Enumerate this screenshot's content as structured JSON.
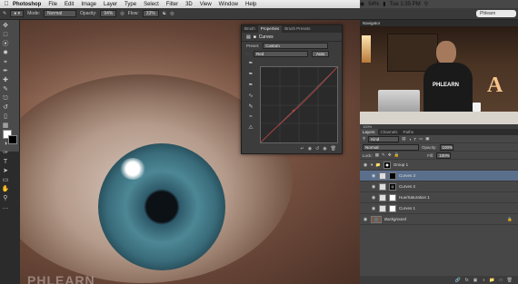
{
  "menubar": {
    "apple": "",
    "app": "Photoshop",
    "items": [
      "File",
      "Edit",
      "Image",
      "Layer",
      "Type",
      "Select",
      "Filter",
      "3D",
      "View",
      "Window",
      "Help"
    ],
    "status": "54%",
    "clock": "Tue 1:35 PM"
  },
  "options": {
    "mode_label": "Mode:",
    "mode_value": "Normal",
    "opacity_label": "Opacity:",
    "opacity_value": "94%",
    "flow_label": "Flow:",
    "flow_value": "33%",
    "search_value": "Phlearn"
  },
  "properties": {
    "tabs": [
      "Brush",
      "Properties",
      "Brush Presets"
    ],
    "title": "Curves",
    "preset_label": "Preset:",
    "preset_value": "Custom",
    "channel_value": "Red",
    "auto_label": "Auto"
  },
  "navigator": {
    "title": "Navigator",
    "zoom": "100%",
    "shirt_text": "PHLEARN",
    "sign_letter": "A"
  },
  "layers": {
    "tabs": [
      "Layers",
      "Channels",
      "Paths"
    ],
    "kind_value": "Kind",
    "blend_value": "Normal",
    "opacity_label": "Opacity:",
    "opacity_value": "100%",
    "lock_label": "Lock:",
    "fill_label": "Fill:",
    "fill_value": "100%",
    "items": [
      {
        "name": "Group 1"
      },
      {
        "name": "Curves 3"
      },
      {
        "name": "Curves 2"
      },
      {
        "name": "Hue/Saturation 1"
      },
      {
        "name": "Curves 1"
      },
      {
        "name": "Background"
      }
    ]
  },
  "canvas": {
    "watermark": "PHLEARN"
  },
  "colors": {
    "selected_layer": "#5a6f8c",
    "curve_line": "#b44"
  }
}
